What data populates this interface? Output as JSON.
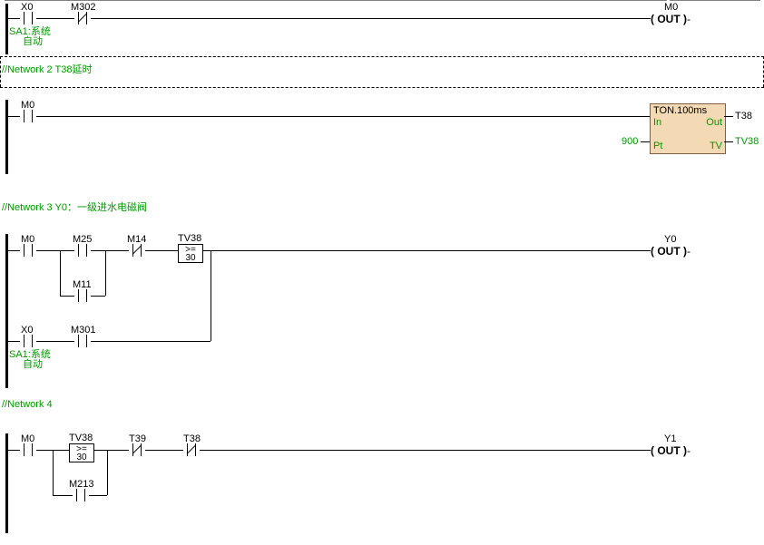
{
  "network1": {
    "x0": "X0",
    "m302": "M302",
    "m0": "M0",
    "out": "( OUT )",
    "sa1": "SA1:系统\n  自动"
  },
  "network2": {
    "title": "//Network 2  T38延时",
    "m0": "M0",
    "fb_title": "TON.100ms",
    "fb_in": "In",
    "fb_out": "Out",
    "fb_pt": "Pt",
    "fb_tv": "TV",
    "pt_val": "900",
    "t38": "T38",
    "tv38": "TV38"
  },
  "network3": {
    "title": "//Network 3  Y0：一级进水电磁阀",
    "m0": "M0",
    "m25": "M25",
    "m14": "M14",
    "tv38": "TV38",
    "cmp_op": ">=",
    "cmp_val": "30",
    "m11": "M11",
    "x0": "X0",
    "m301": "M301",
    "y0": "Y0",
    "out": "( OUT )",
    "sa1": "SA1:系统\n  自动"
  },
  "network4": {
    "title": "//Network 4",
    "m0": "M0",
    "tv38": "TV38",
    "cmp_op": ">=",
    "cmp_val": "30",
    "t39": "T39",
    "t38": "T38",
    "m213": "M213",
    "y1": "Y1",
    "out": "( OUT )"
  }
}
